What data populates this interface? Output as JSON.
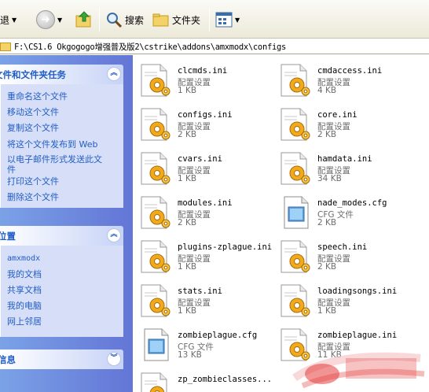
{
  "toolbar": {
    "back_label": "后退",
    "search_label": "搜索",
    "folders_label": "文件夹"
  },
  "address": {
    "path": "F:\\CS1.6 Okgogogo增强普及版2\\cstrike\\addons\\amxmodx\\configs"
  },
  "tasks": {
    "title": "文件和文件夹任务",
    "items": [
      "重命名这个文件",
      "移动这个文件",
      "复制这个文件",
      "将这个文件发布到 Web",
      "以电子邮件形式发送此文件",
      "打印这个文件",
      "删除这个文件"
    ]
  },
  "places": {
    "title": "其它位置",
    "items": [
      "amxmodx",
      "我的文档",
      "共享文档",
      "我的电脑",
      "网上邻居"
    ]
  },
  "details": {
    "title": "详细信息"
  },
  "files": [
    {
      "name": "clcmds.ini",
      "type": "配置设置",
      "size": "1 KB",
      "icon": "config-settings-icon"
    },
    {
      "name": "cmdaccess.ini",
      "type": "配置设置",
      "size": "4 KB",
      "icon": "config-settings-icon"
    },
    {
      "name": "configs.ini",
      "type": "配置设置",
      "size": "2 KB",
      "icon": "config-settings-icon"
    },
    {
      "name": "core.ini",
      "type": "配置设置",
      "size": "2 KB",
      "icon": "config-settings-icon"
    },
    {
      "name": "cvars.ini",
      "type": "配置设置",
      "size": "1 KB",
      "icon": "config-settings-icon"
    },
    {
      "name": "hamdata.ini",
      "type": "配置设置",
      "size": "34 KB",
      "icon": "config-settings-icon"
    },
    {
      "name": "modules.ini",
      "type": "配置设置",
      "size": "2 KB",
      "icon": "config-settings-icon"
    },
    {
      "name": "nade_modes.cfg",
      "type": "CFG 文件",
      "size": "2 KB",
      "icon": "cfg-file-icon"
    },
    {
      "name": "plugins-zplague.ini",
      "type": "配置设置",
      "size": "1 KB",
      "icon": "config-settings-icon"
    },
    {
      "name": "speech.ini",
      "type": "配置设置",
      "size": "2 KB",
      "icon": "config-settings-icon"
    },
    {
      "name": "stats.ini",
      "type": "配置设置",
      "size": "1 KB",
      "icon": "config-settings-icon"
    },
    {
      "name": "loadingsongs.ini",
      "type": "配置设置",
      "size": "1 KB",
      "icon": "config-settings-icon"
    },
    {
      "name": "zombieplague.cfg",
      "type": "CFG 文件",
      "size": "13 KB",
      "icon": "cfg-file-icon"
    },
    {
      "name": "zombieplague.ini",
      "type": "配置设置",
      "size": "11 KB",
      "icon": "config-settings-icon"
    },
    {
      "name": "zp_zombieclasses...",
      "type": "",
      "size": "",
      "icon": "config-settings-icon"
    }
  ]
}
